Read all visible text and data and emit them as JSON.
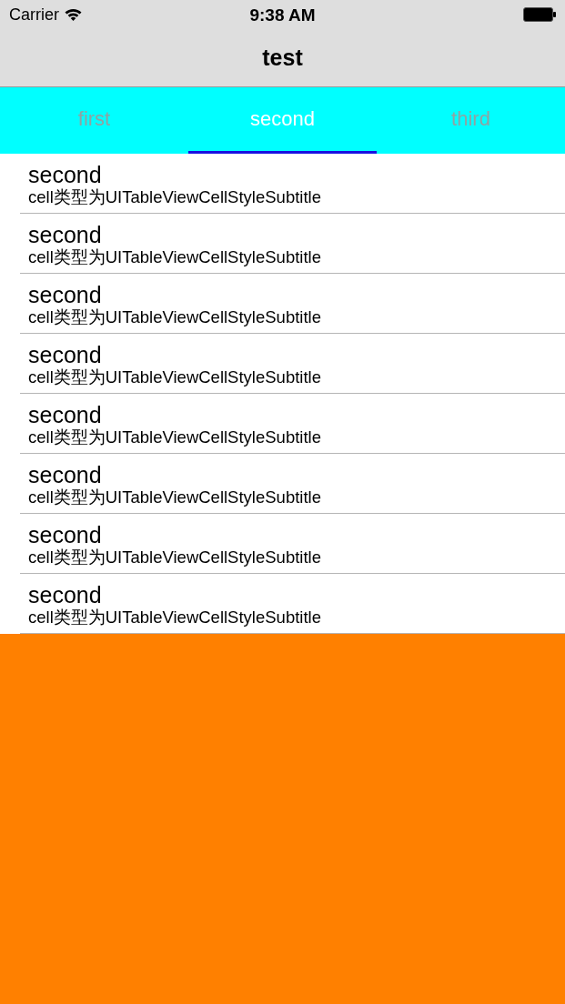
{
  "status_bar": {
    "carrier": "Carrier",
    "time": "9:38 AM"
  },
  "nav_bar": {
    "title": "test"
  },
  "tabs": [
    {
      "label": "first",
      "selected": false
    },
    {
      "label": "second",
      "selected": true
    },
    {
      "label": "third",
      "selected": false
    }
  ],
  "table": {
    "rows": [
      {
        "title": "second",
        "subtitle": "cell类型为UITableViewCellStyleSubtitle"
      },
      {
        "title": "second",
        "subtitle": "cell类型为UITableViewCellStyleSubtitle"
      },
      {
        "title": "second",
        "subtitle": "cell类型为UITableViewCellStyleSubtitle"
      },
      {
        "title": "second",
        "subtitle": "cell类型为UITableViewCellStyleSubtitle"
      },
      {
        "title": "second",
        "subtitle": "cell类型为UITableViewCellStyleSubtitle"
      },
      {
        "title": "second",
        "subtitle": "cell类型为UITableViewCellStyleSubtitle"
      },
      {
        "title": "second",
        "subtitle": "cell类型为UITableViewCellStyleSubtitle"
      },
      {
        "title": "second",
        "subtitle": "cell类型为UITableViewCellStyleSubtitle"
      }
    ]
  }
}
